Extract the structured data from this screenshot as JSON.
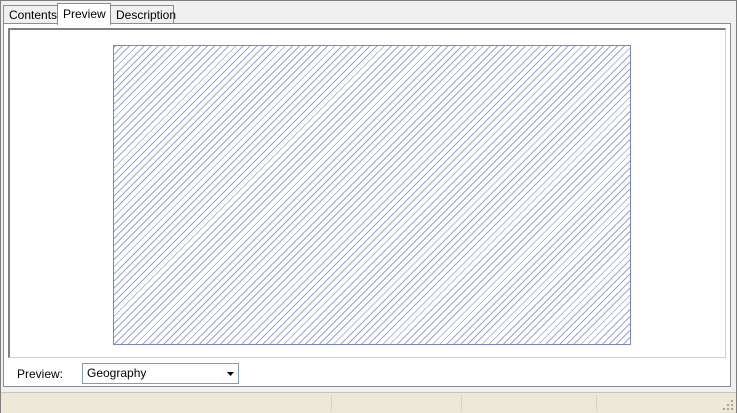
{
  "tabs": [
    {
      "label": "Contents",
      "active": false
    },
    {
      "label": "Preview",
      "active": true
    },
    {
      "label": "Description",
      "active": false
    }
  ],
  "preview": {
    "label": "Preview:",
    "selected": "Geography"
  },
  "colors": {
    "hatch": "#9aa5d3",
    "hatch_border": "#7788c4"
  },
  "icons": {
    "combo_arrow": "triangle-down-icon",
    "grip": "resize-grip-icon"
  }
}
